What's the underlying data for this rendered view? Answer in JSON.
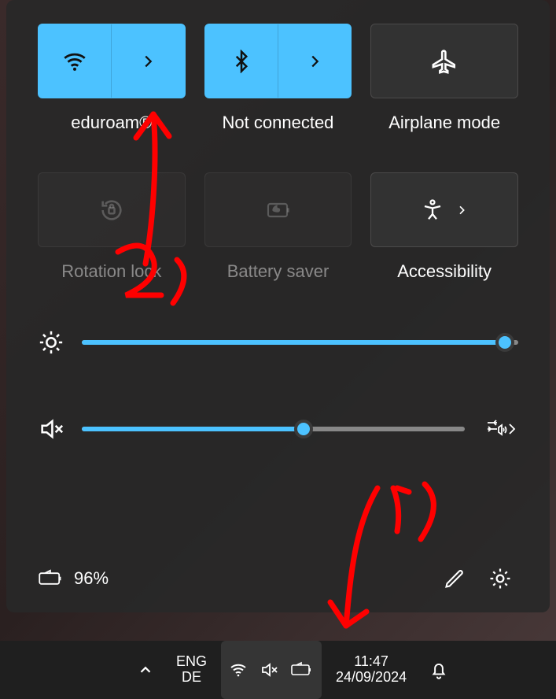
{
  "tiles": {
    "wifi": {
      "label": "eduroam®",
      "active": true,
      "expandable": true
    },
    "bluetooth": {
      "label": "Not connected",
      "active": true,
      "expandable": true
    },
    "airplane": {
      "label": "Airplane mode",
      "active": false,
      "expandable": false
    },
    "rotation": {
      "label": "Rotation lock",
      "active": false,
      "expandable": false,
      "dim": true
    },
    "battery": {
      "label": "Battery saver",
      "active": false,
      "expandable": false,
      "dim": true
    },
    "accessibility": {
      "label": "Accessibility",
      "active": false,
      "expandable": true
    }
  },
  "sliders": {
    "brightness": {
      "value": 97
    },
    "volume": {
      "value": 58
    }
  },
  "status": {
    "battery_text": "96%"
  },
  "taskbar": {
    "lang_top": "ENG",
    "lang_bottom": "DE",
    "time": "11:47",
    "date": "24/09/2024"
  },
  "annotations": {
    "label1": "1)",
    "label2": "2)"
  }
}
